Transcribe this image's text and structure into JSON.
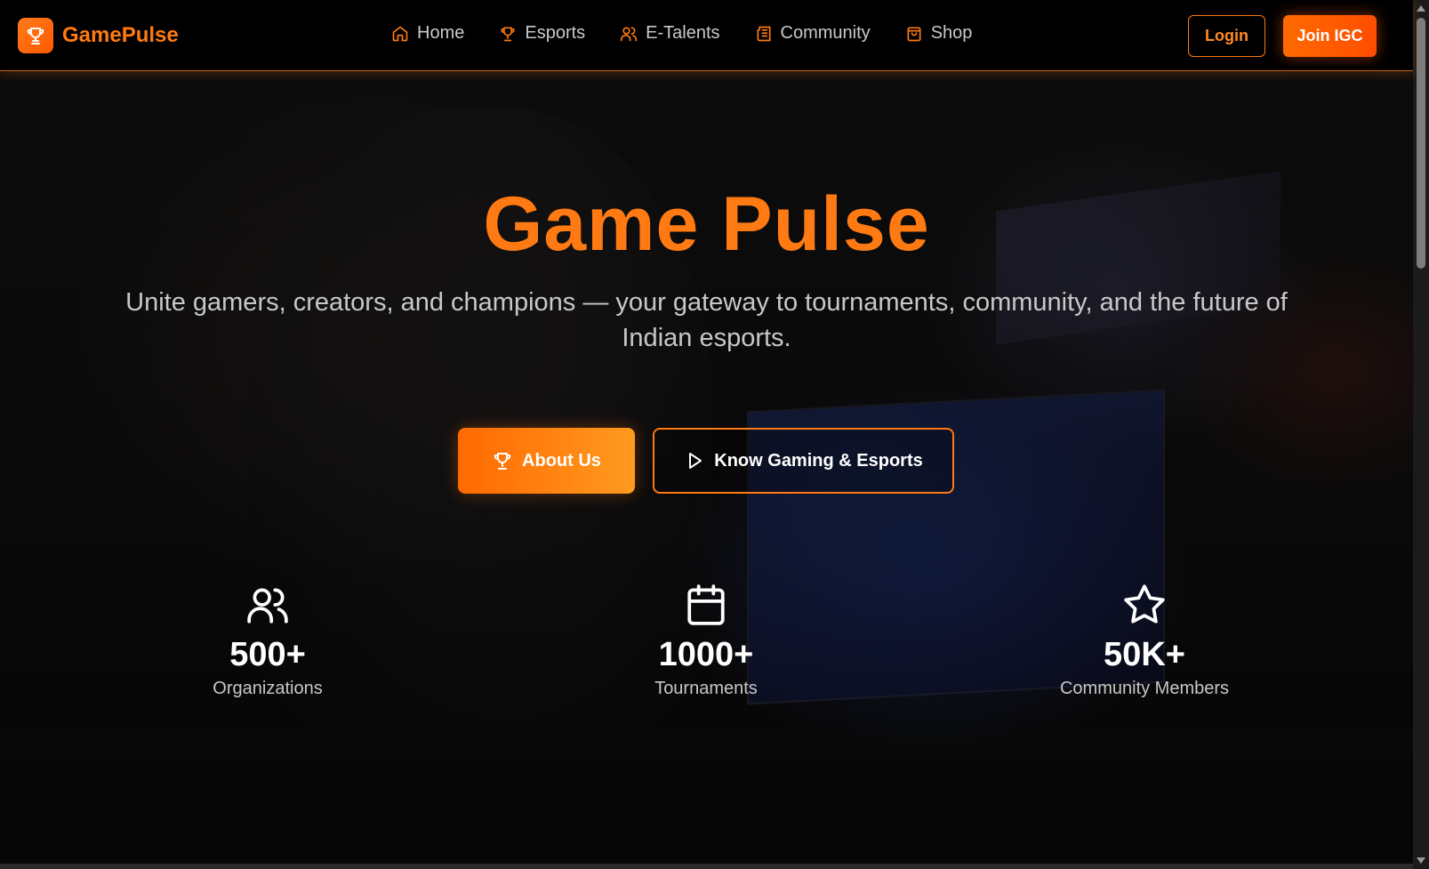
{
  "brand": {
    "name": "GamePulse",
    "logo_icon": "trophy-icon",
    "accent": "#ff7a12"
  },
  "nav": {
    "items": [
      {
        "label": "Home",
        "icon": "home-icon"
      },
      {
        "label": "Esports",
        "icon": "trophy-icon"
      },
      {
        "label": "E-Talents",
        "icon": "users-icon"
      },
      {
        "label": "Community",
        "icon": "newspaper-icon"
      },
      {
        "label": "Shop",
        "icon": "shopping-bag-icon"
      }
    ],
    "login_label": "Login",
    "join_label": "Join IGC"
  },
  "hero": {
    "title": "Game Pulse",
    "subtitle": "Unite gamers, creators, and champions — your gateway to tournaments, community, and the future of Indian esports.",
    "primary_button": "About Us",
    "secondary_button": "Know Gaming & Esports"
  },
  "stats": [
    {
      "value": "500+",
      "label": "Organizations",
      "icon": "users-icon"
    },
    {
      "value": "1000+",
      "label": "Tournaments",
      "icon": "calendar-icon"
    },
    {
      "value": "50K+",
      "label": "Community Members",
      "icon": "star-icon"
    }
  ],
  "colors": {
    "primary_orange": "#ff6a00",
    "light_orange": "#ff9a1f",
    "background": "#0b0b0c",
    "text_muted": "#c8c8c8"
  }
}
